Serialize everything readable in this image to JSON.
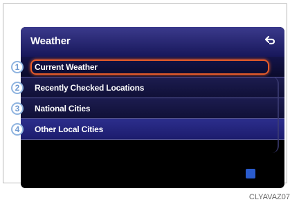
{
  "header": {
    "title": "Weather",
    "back_icon": "back-arrow-icon"
  },
  "menu": {
    "items": [
      {
        "number": "1",
        "label": "Current Weather"
      },
      {
        "number": "2",
        "label": "Recently Checked Locations"
      },
      {
        "number": "3",
        "label": "National Cities"
      },
      {
        "number": "4",
        "label": "Other Local Cities"
      }
    ]
  },
  "caption": "CLYAVAZ07"
}
